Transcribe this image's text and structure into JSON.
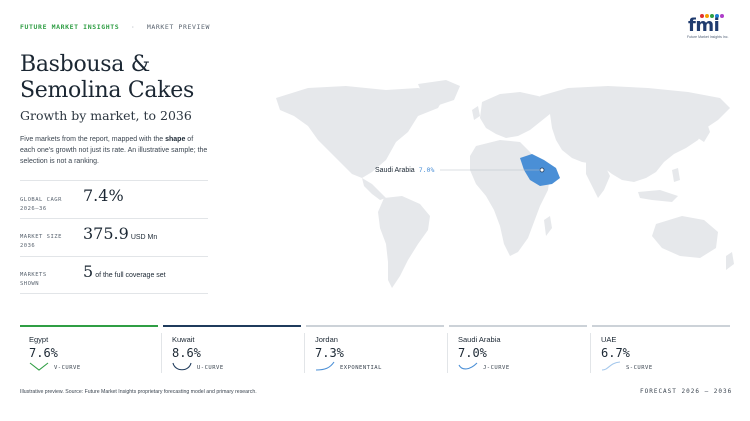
{
  "header": {
    "brand": "FUTURE MARKET INSIGHTS",
    "separator": "·",
    "kind": "MARKET PREVIEW"
  },
  "logo": {
    "wordmark": "fmi",
    "tagline": "Future Market Insights Inc.",
    "dot_colors": [
      "#e03131",
      "#f59f00",
      "#2f9e44",
      "#1c7ed6",
      "#ae3ec9"
    ]
  },
  "title_line1": "Basbousa &",
  "title_line2": "Semolina Cakes",
  "subtitle": "Growth by market, to 2036",
  "description": {
    "before": "Five markets from the report, mapped with the ",
    "bold": "shape",
    "after": " of each one's growth not just its rate. An illustrative sample; the selection is not a ranking."
  },
  "stats": [
    {
      "label_line1": "GLOBAL CAGR",
      "label_line2": "2026–36",
      "value": "7.4%",
      "unit": ""
    },
    {
      "label_line1": "MARKET SIZE",
      "label_line2": "2036",
      "value": "375.9",
      "unit": "USD Mn"
    },
    {
      "label_line1": "MARKETS",
      "label_line2": "SHOWN",
      "value": "5",
      "unit": "of the full coverage set"
    }
  ],
  "map": {
    "highlight_color": "#4a8fd6",
    "land_color": "#e6e8eb",
    "callout": {
      "name": "Saudi Arabia",
      "value": "7.0%"
    }
  },
  "markets": [
    {
      "name": "Egypt",
      "cagr": "7.6%",
      "shape": "V-CURVE",
      "accent": "#2f9e44",
      "glyph": "v-curve-icon"
    },
    {
      "name": "Kuwait",
      "cagr": "8.6%",
      "shape": "U-CURVE",
      "accent": "#1f3b5c",
      "glyph": "u-curve-icon"
    },
    {
      "name": "Jordan",
      "cagr": "7.3%",
      "shape": "EXPONENTIAL",
      "accent": "#ccd2d8",
      "glyph": "exponential-icon"
    },
    {
      "name": "Saudi Arabia",
      "cagr": "7.0%",
      "shape": "J-CURVE",
      "accent": "#ccd2d8",
      "glyph": "j-curve-icon"
    },
    {
      "name": "UAE",
      "cagr": "6.7%",
      "shape": "S-CURVE",
      "accent": "#ccd2d8",
      "glyph": "s-curve-icon"
    }
  ],
  "footnote": "Illustrative preview. Source: Future Market Insights proprietary forecasting model and primary research.",
  "forecast": "FORECAST 2026 – 2036"
}
